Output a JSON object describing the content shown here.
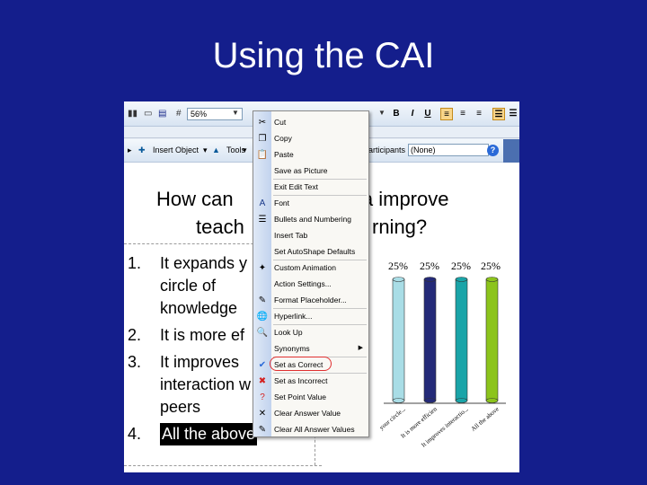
{
  "slide": {
    "title": "Using the CAI"
  },
  "toolbar": {
    "zoom": "56%",
    "bold": "B",
    "italic": "I",
    "underline": "U",
    "insert_object": "Insert Object",
    "tools": "Tools",
    "participants": "articipants",
    "none_value": "(None)"
  },
  "question": {
    "line1_left": "How can",
    "line1_right": "ia improve",
    "line2_left": "teach",
    "line2_right": "rning?"
  },
  "answers": [
    {
      "num": "1.",
      "lines": [
        "It expands y",
        "circle of",
        "knowledge"
      ]
    },
    {
      "num": "2.",
      "lines": [
        "It is more ef"
      ]
    },
    {
      "num": "3.",
      "lines": [
        "It improves",
        "interaction w",
        "peers"
      ]
    },
    {
      "num": "4.",
      "lines": [
        "All the above"
      ]
    }
  ],
  "chart_data": {
    "type": "bar",
    "categories": [
      "It expands your circle...",
      "It is more efficient",
      "It improves interactio...",
      "All the above"
    ],
    "values": [
      25,
      25,
      25,
      25
    ],
    "data_labels": [
      "25%",
      "25%",
      "25%",
      "25%"
    ],
    "tick_labels": [
      "It expands your circle...",
      "It is more efficien",
      "It improves interactio...",
      "All the above"
    ],
    "colors": [
      "#a9dde6",
      "#242a78",
      "#1aa4a8",
      "#8cc41c"
    ]
  },
  "context_menu": {
    "items": [
      {
        "label": "Cut",
        "icon": "scissors-icon"
      },
      {
        "label": "Copy",
        "icon": "copy-icon"
      },
      {
        "label": "Paste",
        "icon": "paste-icon"
      },
      {
        "label": "Save as Picture",
        "icon": ""
      },
      {
        "label": "Exit Edit Text",
        "icon": ""
      },
      {
        "label": "Font",
        "icon": "font-icon"
      },
      {
        "label": "Bullets and Numbering",
        "icon": "bullets-icon"
      },
      {
        "label": "Insert Tab",
        "icon": ""
      },
      {
        "label": "Set AutoShape Defaults",
        "icon": ""
      },
      {
        "label": "Custom Animation",
        "icon": "animation-icon"
      },
      {
        "label": "Action Settings...",
        "icon": ""
      },
      {
        "label": "Format Placeholder...",
        "icon": "format-icon"
      },
      {
        "label": "Hyperlink...",
        "icon": "hyperlink-icon"
      },
      {
        "label": "Look Up",
        "icon": "lookup-icon"
      },
      {
        "label": "Synonyms",
        "icon": ""
      },
      {
        "label": "Set as Correct",
        "icon": "check-icon"
      },
      {
        "label": "Set as Incorrect",
        "icon": "x-icon"
      },
      {
        "label": "Set Point Value",
        "icon": "question-icon"
      },
      {
        "label": "Clear Answer Value",
        "icon": "clear-icon"
      },
      {
        "label": "Clear All Answer Values",
        "icon": "clear-all-icon"
      }
    ]
  }
}
